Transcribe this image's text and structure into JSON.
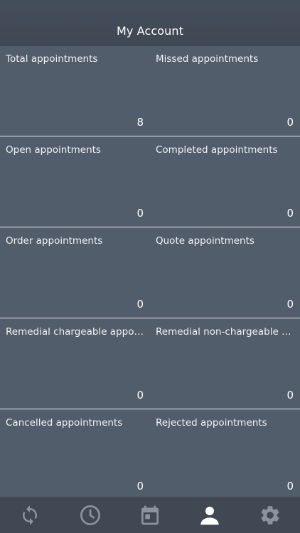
{
  "header": {
    "title": "My Account"
  },
  "stats": [
    {
      "left": {
        "label": "Total appointments",
        "value": "8"
      },
      "right": {
        "label": "Missed appointments",
        "value": "0"
      }
    },
    {
      "left": {
        "label": "Open appointments",
        "value": "0"
      },
      "right": {
        "label": "Completed appointments",
        "value": "0"
      }
    },
    {
      "left": {
        "label": "Order appointments",
        "value": "0"
      },
      "right": {
        "label": "Quote appointments",
        "value": "0"
      }
    },
    {
      "left": {
        "label": "Remedial chargeable appointments",
        "value": "0"
      },
      "right": {
        "label": "Remedial non-chargeable appointments",
        "value": "0"
      }
    },
    {
      "left": {
        "label": "Cancelled appointments",
        "value": "0"
      },
      "right": {
        "label": "Rejected appointments",
        "value": "0"
      }
    }
  ],
  "tabbar": {
    "items": [
      {
        "icon": "sync-icon",
        "active": false
      },
      {
        "icon": "clock-icon",
        "active": false
      },
      {
        "icon": "calendar-icon",
        "active": false
      },
      {
        "icon": "user-icon",
        "active": true
      },
      {
        "icon": "gear-icon",
        "active": false
      }
    ],
    "colors": {
      "active": "#ffffff",
      "inactive": "#8b939e"
    }
  }
}
